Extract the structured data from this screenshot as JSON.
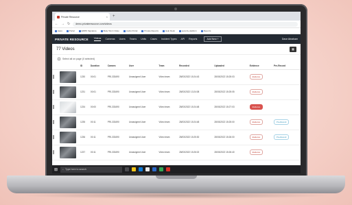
{
  "browser": {
    "tab_title": "Private Resource",
    "url": "demo.privateresource.com/videos",
    "bookmarks": [
      "Apps",
      "Portal",
      "EDRS Signature",
      "Body Worn Video",
      "Audio Portal",
      "Private Reports",
      "Help Desk",
      "security platform",
      "Reports"
    ]
  },
  "app": {
    "logo": "PRIVATE RESOURCE",
    "nav": [
      "Videos",
      "Cameras",
      "Users",
      "Teams",
      "Units",
      "Cases",
      "Incident Types",
      "API",
      "Reports"
    ],
    "add_new": "Add New  +",
    "user": "Dave Abraham"
  },
  "page": {
    "title": "77 Videos",
    "select_all": "Select all on page (0 selected)"
  },
  "table": {
    "headers": [
      "ID",
      "Duration",
      "Camera",
      "User",
      "Team",
      "Recorded",
      "Uploaded",
      "Evidence",
      "Pre-Record"
    ],
    "rows": [
      {
        "thumb": "dark",
        "id": "1230",
        "duration": "00:01",
        "camera": "PRI-333490",
        "user": "Unassigned User",
        "team": "Video team",
        "recorded": "28/03/2022 15:24:43",
        "uploaded": "28/03/2022 15:25:03",
        "evidence": "Evidence",
        "evidence_on": false,
        "prerecord": ""
      },
      {
        "thumb": "dark",
        "id": "1231",
        "duration": "00:01",
        "camera": "PRI-333490",
        "user": "Unassigned User",
        "team": "Video team",
        "recorded": "28/03/2022 13:24:08",
        "uploaded": "28/03/2022 15:25:05",
        "evidence": "Evidence",
        "evidence_on": false,
        "prerecord": ""
      },
      {
        "thumb": "light",
        "id": "1234",
        "duration": "00:00",
        "camera": "PRI-333490",
        "user": "Unassigned User",
        "team": "Video team",
        "recorded": "28/03/2022 15:24:48",
        "uploaded": "28/03/2022 15:27:03",
        "evidence": "Evidence",
        "evidence_on": true,
        "prerecord": ""
      },
      {
        "thumb": "dark",
        "id": "1235",
        "duration": "00:11",
        "camera": "PRI-333490",
        "user": "Unassigned User",
        "team": "Video team",
        "recorded": "28/03/2022 15:24:48",
        "uploaded": "28/03/2022 15:25:00",
        "evidence": "Evidence",
        "evidence_on": false,
        "prerecord": "Pre-Record"
      },
      {
        "thumb": "dark",
        "id": "1236",
        "duration": "00:11",
        "camera": "PRI-333490",
        "user": "Unassigned User",
        "team": "Video team",
        "recorded": "28/03/2022 15:25:30",
        "uploaded": "28/03/2022 15:26:00",
        "evidence": "Evidence",
        "evidence_on": false,
        "prerecord": "Pre-Record"
      },
      {
        "thumb": "dark",
        "id": "1237",
        "duration": "00:11",
        "camera": "PRI-333490",
        "user": "Unassigned User",
        "team": "Video team",
        "recorded": "28/03/2022 15:26:02",
        "uploaded": "28/03/2022 15:26:40",
        "evidence": "Evidence",
        "evidence_on": false,
        "prerecord": ""
      }
    ]
  },
  "taskbar": {
    "search_placeholder": "Type here to search"
  },
  "colors": {
    "navbar": "#232a33",
    "evidence": "#d9534f",
    "prerecord": "#2b8fb8",
    "background": "#f6d6cf"
  }
}
